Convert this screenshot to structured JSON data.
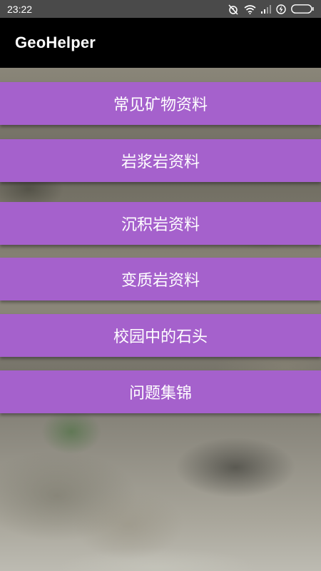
{
  "status_bar": {
    "time": "23:22",
    "icons": [
      "alarm-off-icon",
      "wifi-icon",
      "signal-icon",
      "charging-icon",
      "battery-icon"
    ]
  },
  "app_bar": {
    "title": "GeoHelper"
  },
  "menu": {
    "items": [
      {
        "label": "常见矿物资料"
      },
      {
        "label": "岩浆岩资料"
      },
      {
        "label": "沉积岩资料"
      },
      {
        "label": "变质岩资料"
      },
      {
        "label": "校园中的石头"
      },
      {
        "label": "问题集锦"
      }
    ]
  },
  "colors": {
    "button_bg": "#a561cc",
    "app_bar_bg": "#000000",
    "status_bar_bg": "#4a4a4a",
    "text": "#ffffff"
  }
}
